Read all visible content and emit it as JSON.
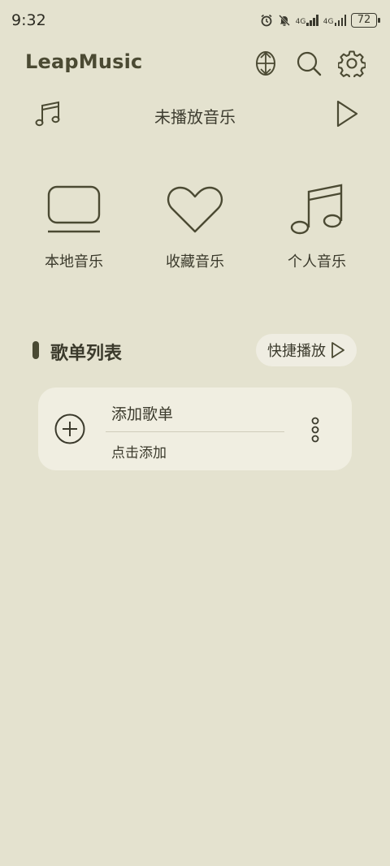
{
  "status": {
    "time": "9:32",
    "battery": "72",
    "net1": "4G",
    "net2": "4G"
  },
  "app": {
    "title": "LeapMusic"
  },
  "now_playing": {
    "title": "未播放音乐"
  },
  "categories": [
    {
      "label": "本地音乐",
      "icon": "monitor-icon"
    },
    {
      "label": "收藏音乐",
      "icon": "heart-icon"
    },
    {
      "label": "个人音乐",
      "icon": "music-note-icon"
    }
  ],
  "section": {
    "title": "歌单列表",
    "quick_play": "快捷播放"
  },
  "playlist_card": {
    "title": "添加歌单",
    "subtitle": "点击添加"
  },
  "colors": {
    "background": "#e4e2cf",
    "card": "#f0eee1",
    "accent": "#4b4a33"
  }
}
